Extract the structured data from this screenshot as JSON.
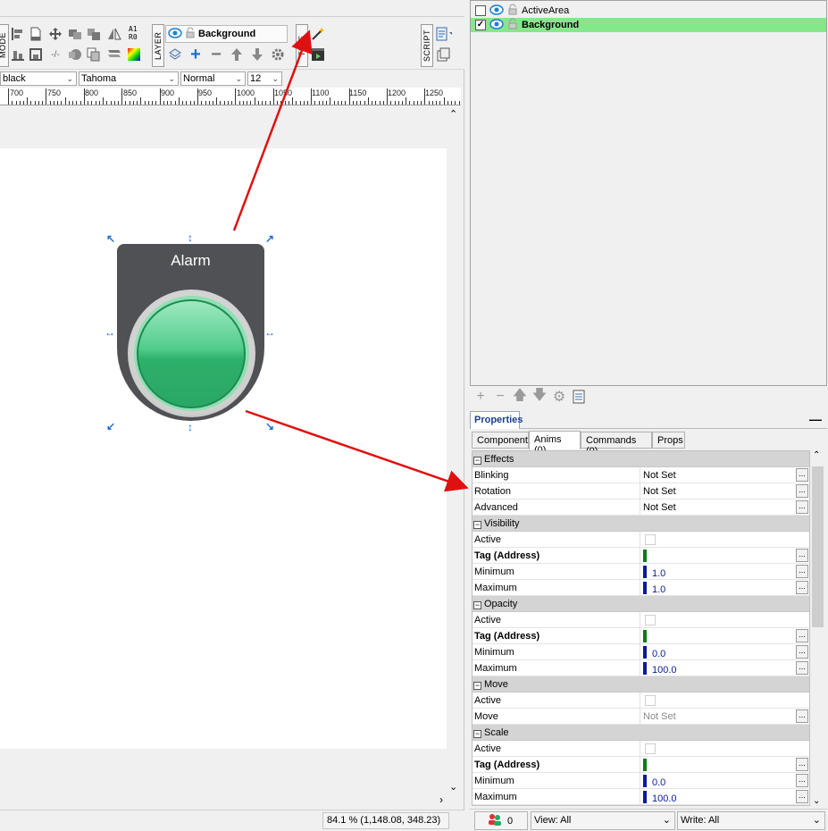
{
  "toolbar": {
    "mode_tab": "MODE",
    "layer_tab": "LAYER",
    "time_tab": "TIME",
    "script_tab": "SCRIPT",
    "tag_text": "A1\nR0",
    "current_layer": "Background"
  },
  "format_bar": {
    "color": "black",
    "font": "Tahoma",
    "style": "Normal",
    "size": "12"
  },
  "ruler": {
    "labels": [
      "700",
      "750",
      "800",
      "850",
      "900",
      "950",
      "1000",
      "1050",
      "1100",
      "1150",
      "1200",
      "1250"
    ]
  },
  "canvas": {
    "alarm_label": "Alarm"
  },
  "status_left": {
    "zoom_coords": "84.1 % (1,148.08, 348.23)"
  },
  "layers": {
    "items": [
      {
        "name": "ActiveArea",
        "checked": false,
        "selected": false
      },
      {
        "name": "Background",
        "checked": true,
        "selected": true
      }
    ]
  },
  "properties": {
    "title": "Properties",
    "minimize": "—",
    "tabs": [
      "Component",
      "Anims (0)",
      "Commands (0)",
      "Props"
    ],
    "active_tab": "Anims (0)",
    "rows": [
      {
        "type": "cat",
        "label": "Effects"
      },
      {
        "type": "prop",
        "label": "Blinking",
        "value": "Not Set",
        "btn": true
      },
      {
        "type": "prop",
        "label": "Rotation",
        "value": "Not Set",
        "btn": true
      },
      {
        "type": "prop",
        "label": "Advanced",
        "value": "Not Set",
        "btn": true
      },
      {
        "type": "cat",
        "label": "Visibility"
      },
      {
        "type": "check",
        "label": "Active"
      },
      {
        "type": "tag",
        "label": "Tag (Address)",
        "bold": true,
        "btn": true
      },
      {
        "type": "num",
        "label": "Minimum",
        "value": "1.0",
        "btn": true
      },
      {
        "type": "num",
        "label": "Maximum",
        "value": "1.0",
        "btn": true
      },
      {
        "type": "cat",
        "label": "Opacity"
      },
      {
        "type": "check",
        "label": "Active"
      },
      {
        "type": "tag",
        "label": "Tag (Address)",
        "bold": true,
        "btn": true
      },
      {
        "type": "num",
        "label": "Minimum",
        "value": "0.0",
        "btn": true
      },
      {
        "type": "num",
        "label": "Maximum",
        "value": "100.0",
        "btn": true
      },
      {
        "type": "cat",
        "label": "Move"
      },
      {
        "type": "check",
        "label": "Active"
      },
      {
        "type": "prop",
        "label": "Move",
        "value": "Not Set",
        "dim": true,
        "btn": true
      },
      {
        "type": "cat",
        "label": "Scale"
      },
      {
        "type": "check",
        "label": "Active"
      },
      {
        "type": "tag",
        "label": "Tag (Address)",
        "bold": true,
        "btn": true
      },
      {
        "type": "num",
        "label": "Minimum",
        "value": "0.0",
        "btn": true
      },
      {
        "type": "num",
        "label": "Maximum",
        "value": "100.0",
        "btn": true
      }
    ]
  },
  "status_right": {
    "users_count": "0",
    "view": "View: All",
    "write": "Write: All"
  },
  "colors": {
    "selected_layer": "#86e78a",
    "alarm_body": "#505154",
    "button_green": "#2db06a",
    "handle_blue": "#1f6fd0",
    "annotation_arrow": "#e01010"
  }
}
